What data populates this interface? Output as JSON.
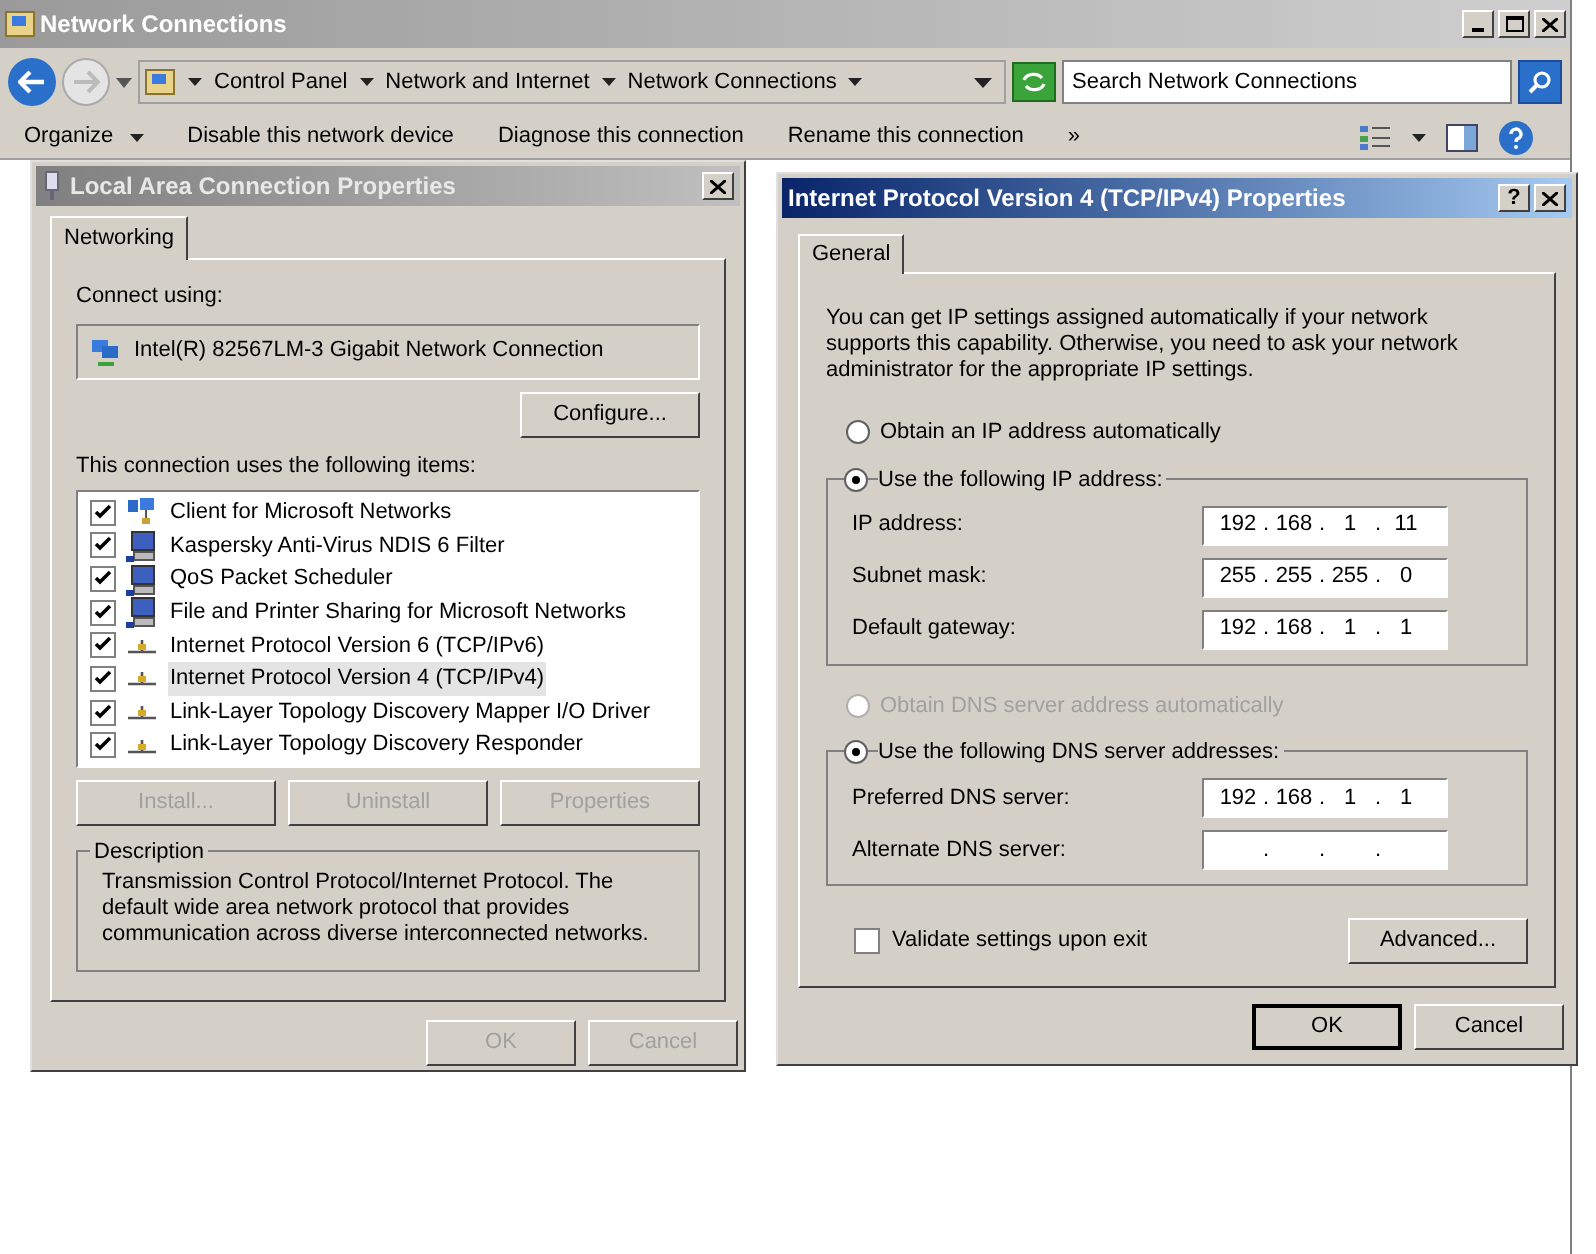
{
  "window": {
    "title": "Network Connections"
  },
  "address": {
    "crumbs": [
      "Control Panel",
      "Network and Internet",
      "Network Connections"
    ],
    "search": {
      "placeholder": "Search Network Connections"
    }
  },
  "toolbar": [
    {
      "label": "Organize",
      "dropdown": true
    },
    {
      "label": "Disable this network device",
      "dropdown": false
    },
    {
      "label": "Diagnose this connection",
      "dropdown": false
    },
    {
      "label": "Rename this connection",
      "dropdown": false
    },
    {
      "label": "»",
      "dropdown": false
    }
  ],
  "lan_dialog": {
    "title": "Local Area Connection Properties",
    "tabs": [
      {
        "label": "Networking",
        "selected": true
      }
    ],
    "connect_label": "Connect using:",
    "adapter": "Intel(R) 82567LM-3 Gigabit Network Connection",
    "configure": "Configure...",
    "items_label": "This connection uses the following items:",
    "items": [
      {
        "label": "Client for Microsoft Networks",
        "checked": true,
        "selected": false,
        "kind": "client"
      },
      {
        "label": "Kaspersky Anti-Virus NDIS 6 Filter",
        "checked": true,
        "selected": false,
        "kind": "service"
      },
      {
        "label": "QoS Packet Scheduler",
        "checked": true,
        "selected": false,
        "kind": "service"
      },
      {
        "label": "File and Printer Sharing for Microsoft Networks",
        "checked": true,
        "selected": false,
        "kind": "service"
      },
      {
        "label": "Internet Protocol Version 6 (TCP/IPv6)",
        "checked": true,
        "selected": false,
        "kind": "protocol"
      },
      {
        "label": "Internet Protocol Version 4 (TCP/IPv4)",
        "checked": true,
        "selected": true,
        "kind": "protocol"
      },
      {
        "label": "Link-Layer Topology Discovery Mapper I/O Driver",
        "checked": true,
        "selected": false,
        "kind": "protocol"
      },
      {
        "label": "Link-Layer Topology Discovery Responder",
        "checked": true,
        "selected": false,
        "kind": "protocol"
      }
    ],
    "item_buttons": [
      {
        "label": "Install...",
        "disabled": true
      },
      {
        "label": "Uninstall",
        "disabled": true
      },
      {
        "label": "Properties",
        "disabled": true
      }
    ],
    "description": {
      "title": "Description",
      "text": "Transmission Control Protocol/Internet Protocol. The default wide area network protocol that provides communication across diverse interconnected networks."
    },
    "footer": [
      {
        "label": "OK",
        "disabled": true
      },
      {
        "label": "Cancel",
        "disabled": true
      }
    ]
  },
  "ip_dialog": {
    "title": "Internet Protocol Version 4 (TCP/IPv4) Properties",
    "help": "?",
    "tabs": [
      {
        "label": "General",
        "selected": true
      }
    ],
    "intro": "You can get IP settings assigned automatically if your network supports this capability. Otherwise, you need to ask your network administrator for the appropriate IP settings.",
    "separator": ".",
    "ip_auto": {
      "label": "Obtain an IP address automatically",
      "selected": false,
      "disabled": false
    },
    "ip_manual": {
      "label": "Use the following IP address:",
      "selected": true,
      "disabled": false
    },
    "ip_fields": [
      {
        "label": "IP address:",
        "octets": [
          "192",
          "168",
          "1",
          "11"
        ]
      },
      {
        "label": "Subnet mask:",
        "octets": [
          "255",
          "255",
          "255",
          "0"
        ]
      },
      {
        "label": "Default gateway:",
        "octets": [
          "192",
          "168",
          "1",
          "1"
        ]
      }
    ],
    "dns_auto": {
      "label": "Obtain DNS server address automatically",
      "selected": false,
      "disabled": true
    },
    "dns_manual": {
      "label": "Use the following DNS server addresses:",
      "selected": true,
      "disabled": false
    },
    "dns_fields": [
      {
        "label": "Preferred DNS server:",
        "octets": [
          "192",
          "168",
          "1",
          "1"
        ]
      },
      {
        "label": "Alternate DNS server:"
      }
    ],
    "validate": {
      "label": "Validate settings upon exit",
      "checked": false
    },
    "advanced": "Advanced...",
    "footer": [
      {
        "label": "OK",
        "default": true
      },
      {
        "label": "Cancel",
        "default": false
      }
    ]
  }
}
